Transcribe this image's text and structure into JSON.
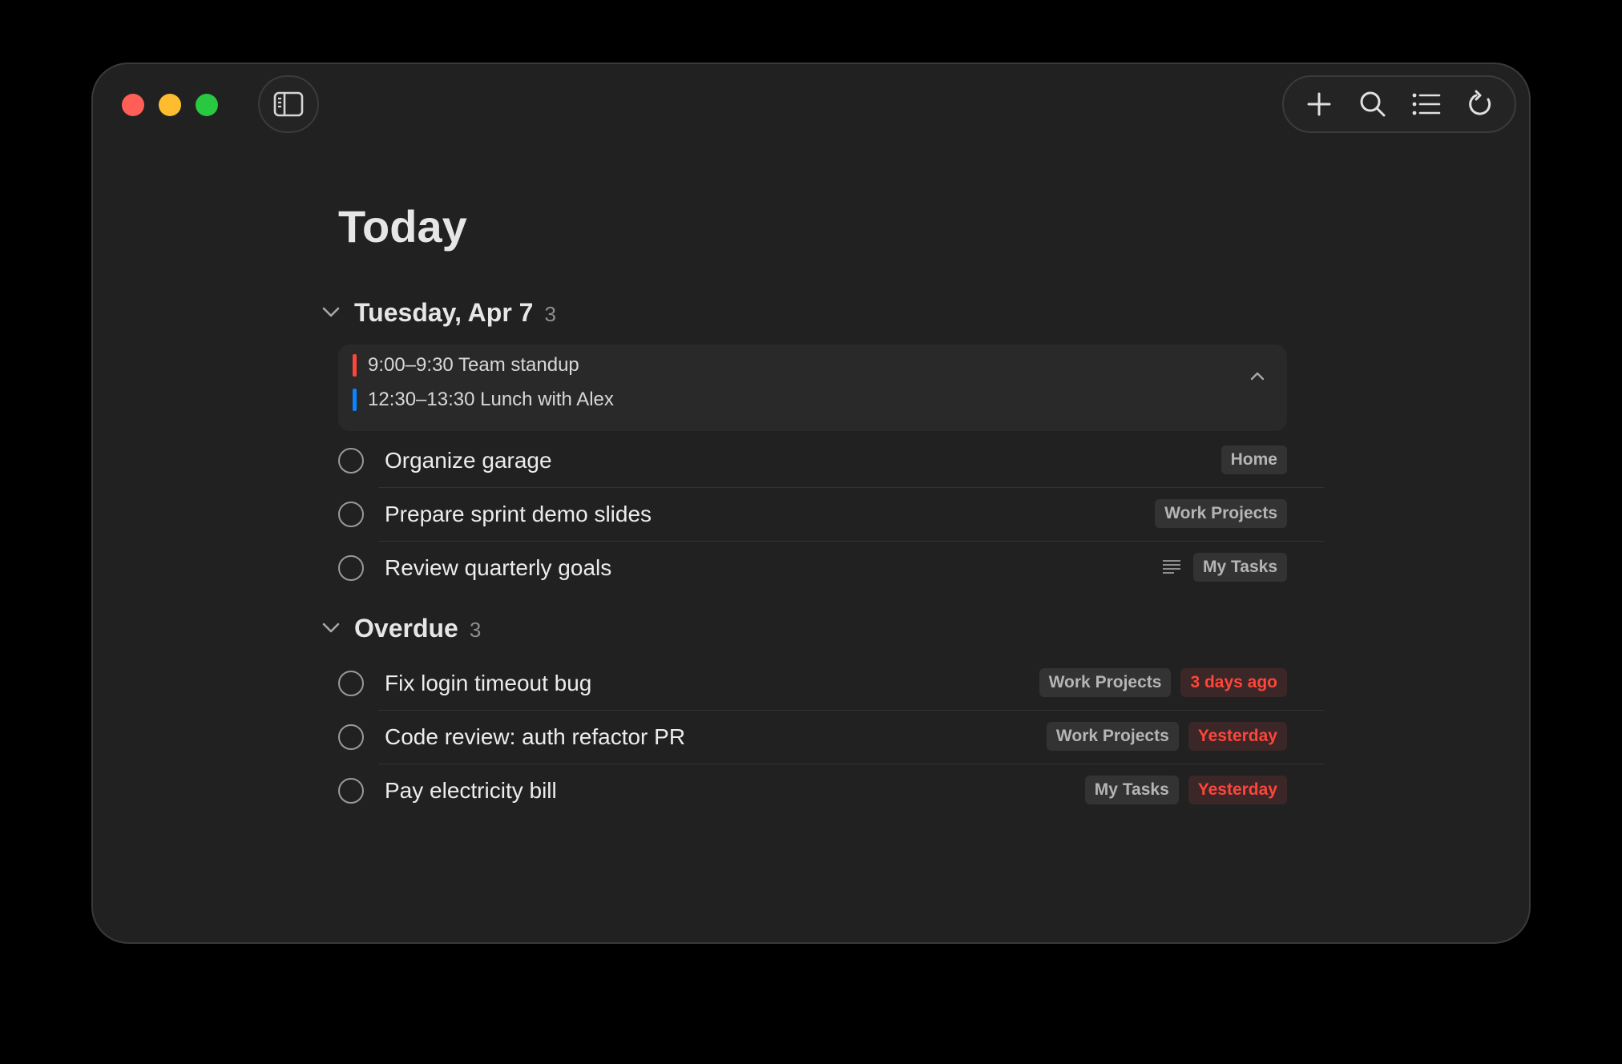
{
  "window": {
    "controls": [
      "close",
      "minimize",
      "maximize"
    ]
  },
  "toolbar": {
    "icons": [
      "sidebar-icon",
      "plus-icon",
      "search-icon",
      "list-icon",
      "refresh-icon"
    ]
  },
  "page": {
    "title": "Today"
  },
  "sections": [
    {
      "title": "Tuesday, Apr 7",
      "count": "3",
      "events": [
        {
          "text": "9:00–9:30 Team standup",
          "color": "#ff453a"
        },
        {
          "text": "12:30–13:30 Lunch with Alex",
          "color": "#0a84ff"
        }
      ],
      "tasks": [
        {
          "label": "Organize garage",
          "tags": [
            "Home"
          ],
          "has_notes": false
        },
        {
          "label": "Prepare sprint demo slides",
          "tags": [
            "Work Projects"
          ],
          "has_notes": false
        },
        {
          "label": "Review quarterly goals",
          "tags": [
            "My Tasks"
          ],
          "has_notes": true
        }
      ]
    },
    {
      "title": "Overdue",
      "count": "3",
      "tasks": [
        {
          "label": "Fix login timeout bug",
          "tags": [
            "Work Projects"
          ],
          "due": "3 days ago"
        },
        {
          "label": "Code review: auth refactor PR",
          "tags": [
            "Work Projects"
          ],
          "due": "Yesterday"
        },
        {
          "label": "Pay electricity bill",
          "tags": [
            "My Tasks"
          ],
          "due": "Yesterday"
        }
      ]
    }
  ],
  "colors": {
    "background": "#212121",
    "overdue": "#ff453a",
    "tag_bg": "#333333"
  }
}
